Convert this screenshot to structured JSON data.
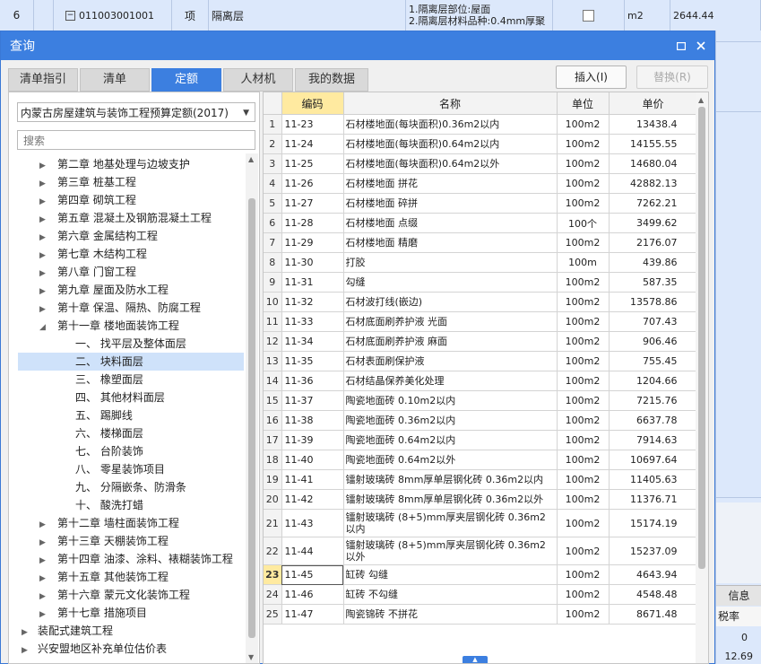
{
  "background": {
    "row": {
      "index": "6",
      "code": "011003001001",
      "type": "项",
      "name": "隔离层",
      "features": [
        "1.隔离层部位:屋面",
        "2.隔离层材料品种:0.4mm厚聚"
      ],
      "unit": "m2",
      "amount": "2644.44"
    },
    "right_labels": {
      "info": "信息",
      "tax": "税率",
      "zero": "0",
      "val": "12.69"
    }
  },
  "dialog": {
    "title": "查询",
    "tabs": [
      {
        "label": "清单指引"
      },
      {
        "label": "清单"
      },
      {
        "label": "定额"
      },
      {
        "label": "人材机"
      },
      {
        "label": "我的数据"
      }
    ],
    "insert_label": "插入(I)",
    "replace_label": "替换(R)",
    "library": "内蒙古房屋建筑与装饰工程预算定额(2017)",
    "search_placeholder": "搜索",
    "tree": [
      {
        "label": "第二章 地基处理与边坡支护"
      },
      {
        "label": "第三章 桩基工程"
      },
      {
        "label": "第四章 砌筑工程"
      },
      {
        "label": "第五章 混凝土及钢筋混凝土工程"
      },
      {
        "label": "第六章 金属结构工程"
      },
      {
        "label": "第七章 木结构工程"
      },
      {
        "label": "第八章 门窗工程"
      },
      {
        "label": "第九章 屋面及防水工程"
      },
      {
        "label": "第十章 保温、隔热、防腐工程"
      },
      {
        "label": "第十一章 楼地面装饰工程"
      },
      {
        "label": "一、 找平层及整体面层"
      },
      {
        "label": "二、 块料面层"
      },
      {
        "label": "三、 橡塑面层"
      },
      {
        "label": "四、 其他材料面层"
      },
      {
        "label": "五、 踢脚线"
      },
      {
        "label": "六、 楼梯面层"
      },
      {
        "label": "七、 台阶装饰"
      },
      {
        "label": "八、 零星装饰项目"
      },
      {
        "label": "九、 分隔嵌条、防滑条"
      },
      {
        "label": "十、 酸洗打蜡"
      },
      {
        "label": "第十二章 墙柱面装饰工程"
      },
      {
        "label": "第十三章 天棚装饰工程"
      },
      {
        "label": "第十四章 油漆、涂料、裱糊装饰工程"
      },
      {
        "label": "第十五章 其他装饰工程"
      },
      {
        "label": "第十六章 蒙元文化装饰工程"
      },
      {
        "label": "第十七章 措施项目"
      },
      {
        "label": "装配式建筑工程"
      },
      {
        "label": "兴安盟地区补充单位估价表"
      }
    ],
    "grid": {
      "headers": {
        "code": "编码",
        "name": "名称",
        "unit": "单位",
        "price": "单价"
      },
      "rows": [
        {
          "n": "1",
          "code": "11-23",
          "name": "石材楼地面(每块面积)0.36m2以内",
          "unit": "100m2",
          "price": "13438.4"
        },
        {
          "n": "2",
          "code": "11-24",
          "name": "石材楼地面(每块面积)0.64m2以内",
          "unit": "100m2",
          "price": "14155.55"
        },
        {
          "n": "3",
          "code": "11-25",
          "name": "石材楼地面(每块面积)0.64m2以外",
          "unit": "100m2",
          "price": "14680.04"
        },
        {
          "n": "4",
          "code": "11-26",
          "name": "石材楼地面 拼花",
          "unit": "100m2",
          "price": "42882.13"
        },
        {
          "n": "5",
          "code": "11-27",
          "name": "石材楼地面 碎拼",
          "unit": "100m2",
          "price": "7262.21"
        },
        {
          "n": "6",
          "code": "11-28",
          "name": "石材楼地面 点缀",
          "unit": "100个",
          "price": "3499.62"
        },
        {
          "n": "7",
          "code": "11-29",
          "name": "石材楼地面 精磨",
          "unit": "100m2",
          "price": "2176.07"
        },
        {
          "n": "8",
          "code": "11-30",
          "name": "打胶",
          "unit": "100m",
          "price": "439.86"
        },
        {
          "n": "9",
          "code": "11-31",
          "name": "勾缝",
          "unit": "100m2",
          "price": "587.35"
        },
        {
          "n": "10",
          "code": "11-32",
          "name": "石材波打线(嵌边)",
          "unit": "100m2",
          "price": "13578.86"
        },
        {
          "n": "11",
          "code": "11-33",
          "name": "石材底面刷养护液 光面",
          "unit": "100m2",
          "price": "707.43"
        },
        {
          "n": "12",
          "code": "11-34",
          "name": "石材底面刷养护液 麻面",
          "unit": "100m2",
          "price": "906.46"
        },
        {
          "n": "13",
          "code": "11-35",
          "name": "石材表面刷保护液",
          "unit": "100m2",
          "price": "755.45"
        },
        {
          "n": "14",
          "code": "11-36",
          "name": "石材结晶保养美化处理",
          "unit": "100m2",
          "price": "1204.66"
        },
        {
          "n": "15",
          "code": "11-37",
          "name": "陶瓷地面砖 0.10m2以内",
          "unit": "100m2",
          "price": "7215.76"
        },
        {
          "n": "16",
          "code": "11-38",
          "name": "陶瓷地面砖 0.36m2以内",
          "unit": "100m2",
          "price": "6637.78"
        },
        {
          "n": "17",
          "code": "11-39",
          "name": "陶瓷地面砖 0.64m2以内",
          "unit": "100m2",
          "price": "7914.63"
        },
        {
          "n": "18",
          "code": "11-40",
          "name": "陶瓷地面砖 0.64m2以外",
          "unit": "100m2",
          "price": "10697.64"
        },
        {
          "n": "19",
          "code": "11-41",
          "name": "镭射玻璃砖 8mm厚单层钢化砖 0.36m2以内",
          "unit": "100m2",
          "price": "11405.63"
        },
        {
          "n": "20",
          "code": "11-42",
          "name": "镭射玻璃砖 8mm厚单层钢化砖 0.36m2以外",
          "unit": "100m2",
          "price": "11376.71"
        },
        {
          "n": "21",
          "code": "11-43",
          "name": "镭射玻璃砖 (8+5)mm厚夹层钢化砖 0.36m2以内",
          "unit": "100m2",
          "price": "15174.19"
        },
        {
          "n": "22",
          "code": "11-44",
          "name": "镭射玻璃砖 (8+5)mm厚夹层钢化砖 0.36m2以外",
          "unit": "100m2",
          "price": "15237.09"
        },
        {
          "n": "23",
          "code": "11-45",
          "name": "缸砖 勾缝",
          "unit": "100m2",
          "price": "4643.94"
        },
        {
          "n": "24",
          "code": "11-46",
          "name": "缸砖 不勾缝",
          "unit": "100m2",
          "price": "4548.48"
        },
        {
          "n": "25",
          "code": "11-47",
          "name": "陶瓷锦砖 不拼花",
          "unit": "100m2",
          "price": "8671.48"
        }
      ]
    }
  }
}
